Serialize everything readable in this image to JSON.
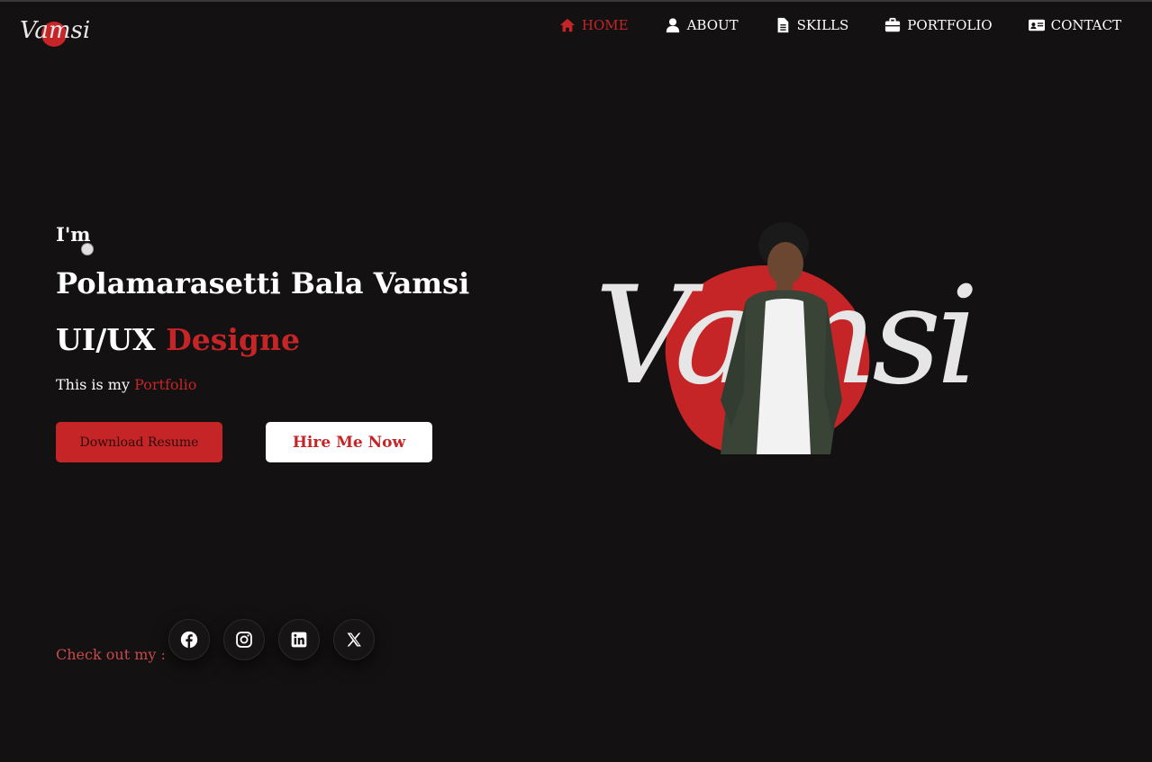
{
  "logo": {
    "text": "Vamsi"
  },
  "nav": {
    "items": [
      {
        "label": "HOME",
        "icon": "home-icon",
        "active": true
      },
      {
        "label": "ABOUT",
        "icon": "user-icon",
        "active": false
      },
      {
        "label": "SKILLS",
        "icon": "document-icon",
        "active": false
      },
      {
        "label": "PORTFOLIO",
        "icon": "briefcase-icon",
        "active": false
      },
      {
        "label": "CONTACT",
        "icon": "address-card-icon",
        "active": false
      }
    ]
  },
  "hero": {
    "greeting": "I'm",
    "name": "Polamarasetti Bala Vamsi",
    "role_prefix": "UI/UX",
    "role_accent": "Designe",
    "tagline_prefix": "This is my",
    "tagline_accent": "Portfolio",
    "download_label": "Download Resume",
    "hire_label": "Hire Me Now",
    "art_text": "Vamsi"
  },
  "social": {
    "label": "Check out my :",
    "links": [
      "facebook-icon",
      "instagram-icon",
      "linkedin-icon",
      "x-icon"
    ]
  },
  "colors": {
    "background": "#131111",
    "accent": "#c62527",
    "text": "#ffffff"
  }
}
